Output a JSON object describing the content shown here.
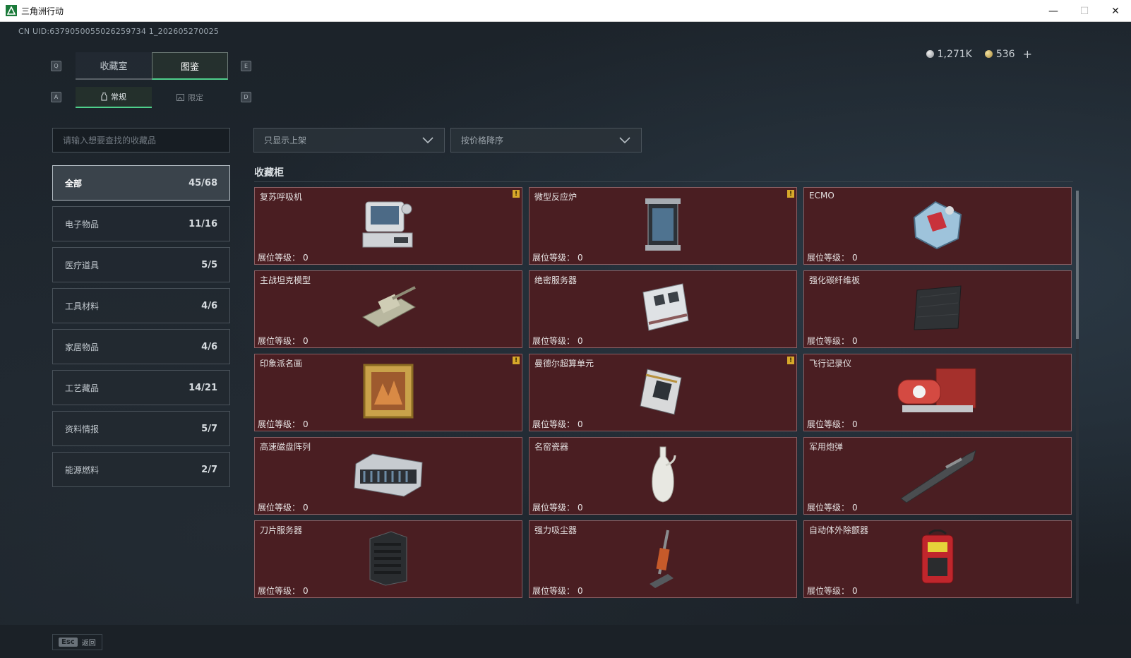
{
  "window": {
    "title": "三角洲行动",
    "min": "—",
    "max": "☐",
    "close": "✕"
  },
  "uid": "CN UID:6379050055026259734 1_202605270025",
  "currency": {
    "silver": "1,271K",
    "gold": "536",
    "add": "+"
  },
  "keys": {
    "q": "Q",
    "e": "E",
    "a": "A",
    "d": "D"
  },
  "tabs": [
    {
      "label": "收藏室",
      "active": false
    },
    {
      "label": "图鉴",
      "active": true
    }
  ],
  "subtabs": [
    {
      "label": "常规",
      "active": true
    },
    {
      "label": "限定",
      "active": false
    }
  ],
  "search": {
    "placeholder": "请输入想要查找的收藏品"
  },
  "filters": {
    "shelf": "只显示上架",
    "sort": "按价格降序"
  },
  "sidebar": [
    {
      "label": "全部",
      "count": "45/68",
      "active": true
    },
    {
      "label": "电子物品",
      "count": "11/16"
    },
    {
      "label": "医疗道具",
      "count": "5/5"
    },
    {
      "label": "工具材料",
      "count": "4/6"
    },
    {
      "label": "家居物品",
      "count": "4/6"
    },
    {
      "label": "工艺藏品",
      "count": "14/21"
    },
    {
      "label": "资料情报",
      "count": "5/7"
    },
    {
      "label": "能源燃料",
      "count": "2/7"
    }
  ],
  "section_title": "收藏柜",
  "level_label": "展位等级：",
  "items": [
    {
      "name": "复苏呼吸机",
      "level": "0",
      "warn": true,
      "icon": "ventilator-icon"
    },
    {
      "name": "微型反应炉",
      "level": "0",
      "warn": true,
      "icon": "reactor-icon"
    },
    {
      "name": "ECMO",
      "level": "0",
      "warn": false,
      "icon": "ecmo-icon"
    },
    {
      "name": "主战坦克模型",
      "level": "0",
      "warn": false,
      "icon": "tank-model-icon"
    },
    {
      "name": "绝密服务器",
      "level": "0",
      "warn": false,
      "icon": "server-board-icon"
    },
    {
      "name": "强化碳纤维板",
      "level": "0",
      "warn": false,
      "icon": "carbon-plate-icon"
    },
    {
      "name": "印象派名画",
      "level": "0",
      "warn": true,
      "icon": "painting-icon"
    },
    {
      "name": "曼德尔超算单元",
      "level": "0",
      "warn": true,
      "icon": "compute-unit-icon"
    },
    {
      "name": "飞行记录仪",
      "level": "0",
      "warn": false,
      "icon": "flight-recorder-icon"
    },
    {
      "name": "高速磁盘阵列",
      "level": "0",
      "warn": false,
      "icon": "disk-array-icon"
    },
    {
      "name": "名窑瓷器",
      "level": "0",
      "warn": false,
      "icon": "porcelain-vase-icon"
    },
    {
      "name": "军用炮弹",
      "level": "0",
      "warn": false,
      "icon": "artillery-shell-icon"
    },
    {
      "name": "刀片服务器",
      "level": "0",
      "warn": false,
      "icon": "blade-server-icon"
    },
    {
      "name": "强力吸尘器",
      "level": "0",
      "warn": false,
      "icon": "vacuum-cleaner-icon"
    },
    {
      "name": "自动体外除颤器",
      "level": "0",
      "warn": false,
      "icon": "defibrillator-icon"
    }
  ],
  "warn_glyph": "!",
  "bottom": {
    "key": "Esc",
    "label": "返回"
  }
}
